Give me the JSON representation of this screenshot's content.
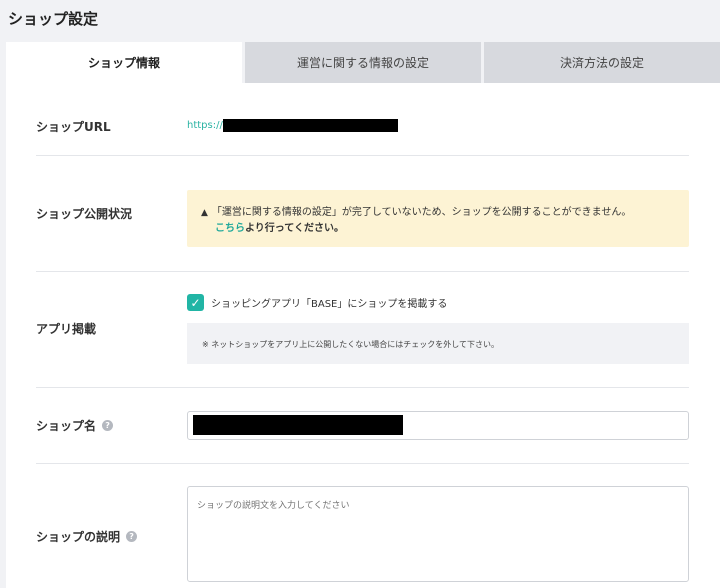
{
  "page": {
    "title": "ショップ設定"
  },
  "tabs": [
    {
      "label": "ショップ情報",
      "active": true
    },
    {
      "label": "運営に関する情報の設定",
      "active": false
    },
    {
      "label": "決済方法の設定",
      "active": false
    }
  ],
  "shop_url": {
    "label": "ショップURL",
    "prefix": "https://",
    "value_redacted": true
  },
  "publish_status": {
    "label": "ショップ公開状況",
    "alert_icon": "warning-triangle-icon",
    "alert_line1": "「運営に関する情報の設定」が完了していないため、ショップを公開することができません。",
    "alert_link": "こちら",
    "alert_line2_suffix": "より行ってください。"
  },
  "app_listing": {
    "label": "アプリ掲載",
    "checkbox_label": "ショッピングアプリ「BASE」にショップを掲載する",
    "checked": true,
    "note": "※ ネットショップをアプリ上に公開したくない場合にはチェックを外して下さい。"
  },
  "shop_name": {
    "label": "ショップ名",
    "help_icon": "question-circle-icon",
    "value_redacted": true
  },
  "shop_description": {
    "label": "ショップの説明",
    "help_icon": "question-circle-icon",
    "placeholder": "ショップの説明文を入力してください"
  },
  "colors": {
    "accent": "#21b5a5",
    "link": "#2bb3a3",
    "alert_bg": "#fdf3d4",
    "tab_inactive": "#d7d9de"
  }
}
